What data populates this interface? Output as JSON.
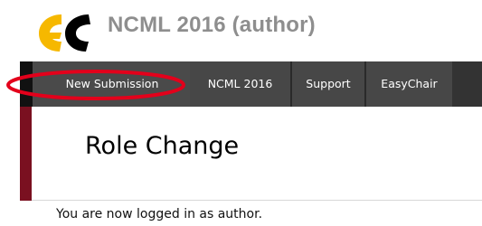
{
  "header": {
    "logo_icon": "easychair-logo-icon",
    "app_title": "NCML 2016 (author)"
  },
  "nav": {
    "items": [
      {
        "label": "New Submission"
      },
      {
        "label": "NCML 2016"
      },
      {
        "label": "Support"
      },
      {
        "label": "EasyChair"
      }
    ],
    "highlight_color": "#e3001b"
  },
  "main": {
    "page_title": "Role Change",
    "status_message": "You are now logged in as author."
  },
  "colors": {
    "accent": "#7a1020",
    "navbar_bg": "#333333",
    "title_gray": "#8e8e8e",
    "logo_yellow": "#f6b800",
    "logo_black": "#000000"
  }
}
